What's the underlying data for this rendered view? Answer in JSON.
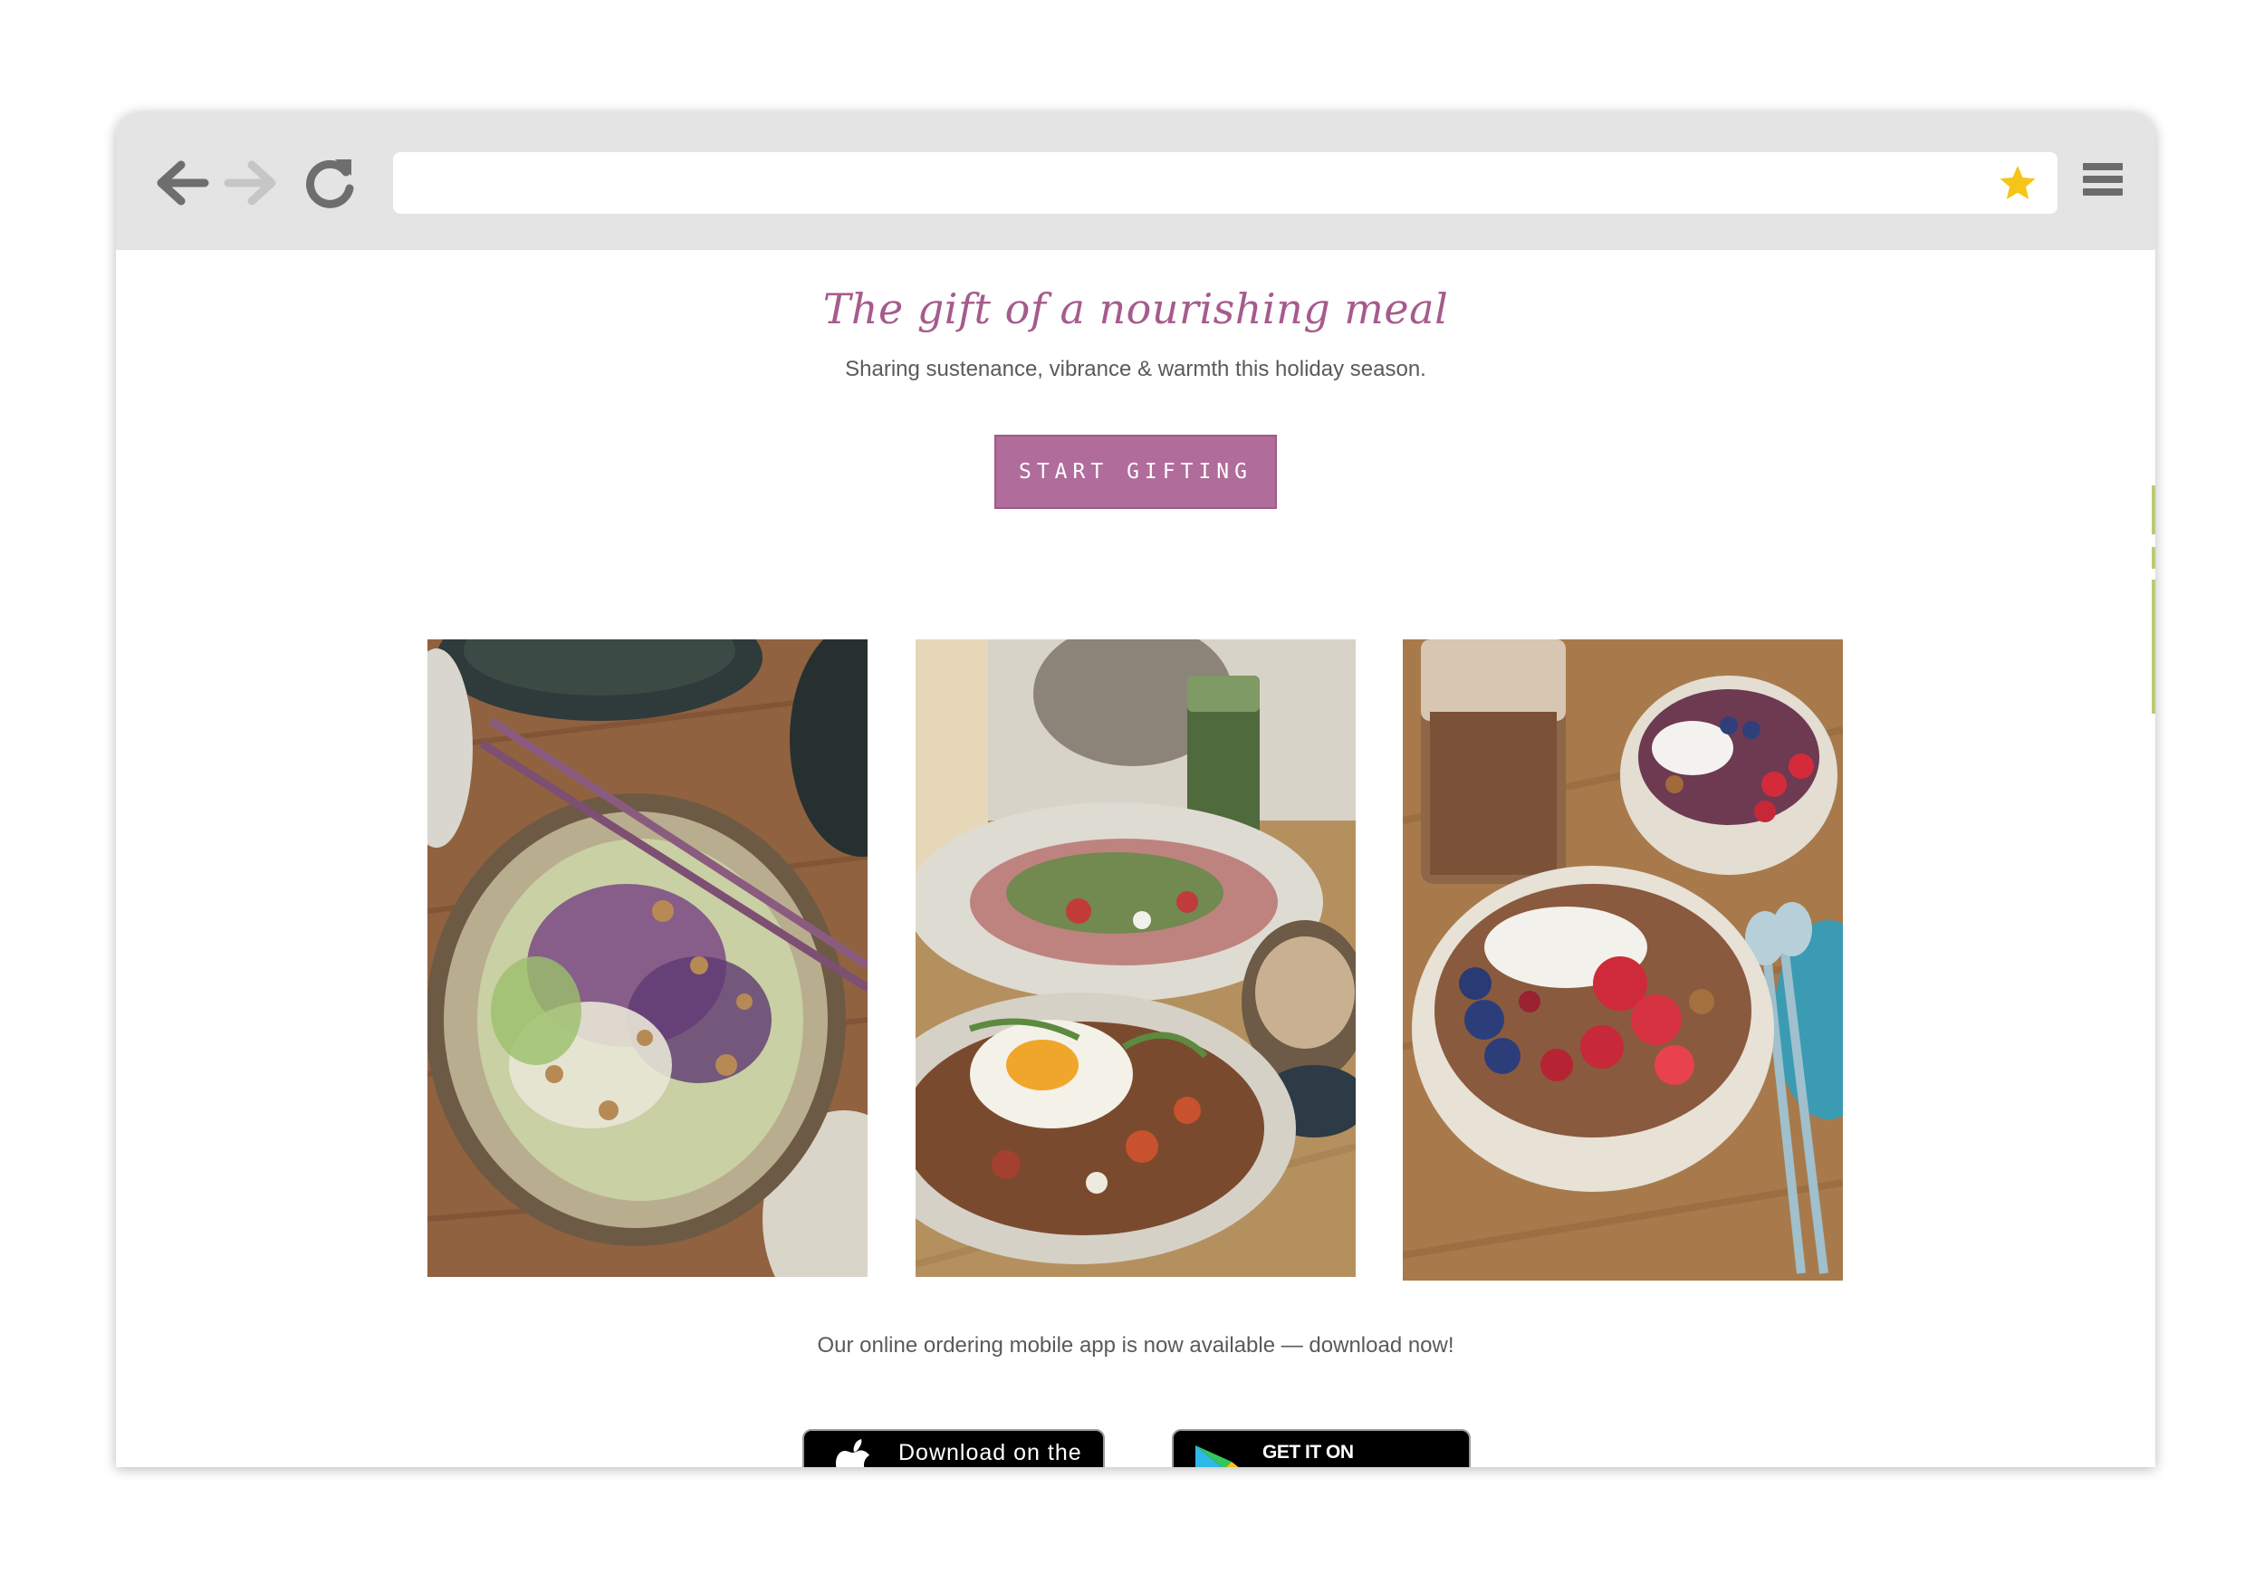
{
  "browser": {
    "url": "",
    "icons": {
      "back": "arrow-left-icon",
      "forward": "arrow-right-icon",
      "reload": "reload-icon",
      "bookmark": "star-icon",
      "menu": "hamburger-menu-icon"
    }
  },
  "page": {
    "headline": "The gift of a nourishing meal",
    "subheadline": "Sharing sustenance, vibrance & warmth this holiday season.",
    "cta_label": "START GIFTING",
    "photos": [
      {
        "subject": "noodle bowl with purple cabbage, walnuts and chopsticks"
      },
      {
        "subject": "plates of roasted vegetables with fried egg and salad"
      },
      {
        "subject": "smoothie bowls with berries, coconut and granola"
      }
    ],
    "app_text": "Our online ordering mobile app is now available — download now!",
    "apple_badge_label": "Download on the",
    "google_badge_label": "GET IT ON"
  },
  "colors": {
    "accent": "#a65b8c",
    "button": "#b06d9b",
    "toolbar": "#e4e4e4",
    "star": "#f5c518"
  }
}
